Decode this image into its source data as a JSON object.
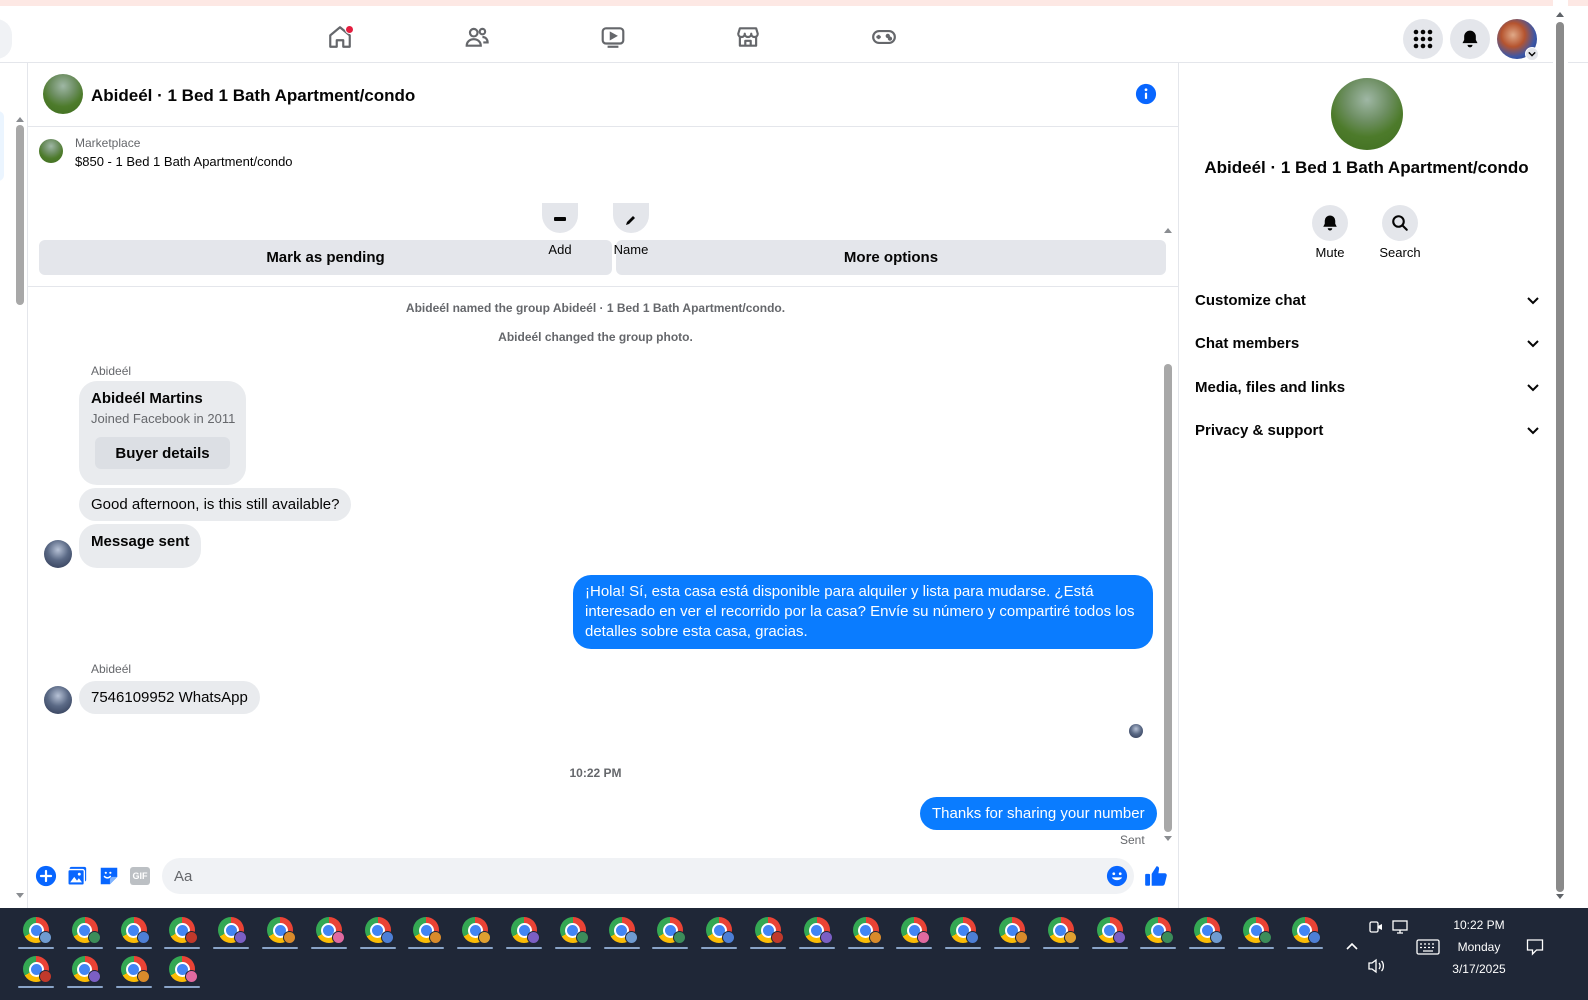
{
  "chat_header": {
    "title": "Abideél · 1 Bed 1 Bath Apartment/condo"
  },
  "marketplace": {
    "label": "Marketplace",
    "listing": "$850 - 1 Bed 1 Bath Apartment/condo",
    "mark_pending": "Mark as pending",
    "more_options": "More options"
  },
  "group_actions": {
    "add": "Add",
    "name": "Name"
  },
  "system_messages": [
    "Abideél named the group Abideél · 1 Bed 1 Bath Apartment/condo.",
    "Abideél changed the group photo."
  ],
  "buyer_card": {
    "sender": "Abideél",
    "name": "Abideél Martins",
    "joined": "Joined Facebook in 2011",
    "details_button": "Buyer details"
  },
  "messages": {
    "m1": "Good afternoon, is this still available?",
    "m2": "Message sent",
    "m3": "¡Hola! Sí, esta casa está disponible para alquiler y lista para mudarse. ¿Está interesado en ver el recorrido por la casa? Envíe su número y compartiré todos los detalles sobre esta casa, gracias.",
    "m4_sender": "Abideél",
    "m4": "7546109952 WhatsApp",
    "timestamp": "10:22 PM",
    "m5": "Thanks for sharing your number",
    "status": "Sent"
  },
  "composer": {
    "placeholder": "Aa",
    "gif": "GIF"
  },
  "right_panel": {
    "title": "Abideél · 1 Bed 1 Bath Apartment/condo",
    "mute": "Mute",
    "search": "Search",
    "sections": [
      "Customize chat",
      "Chat members",
      "Media, files and links",
      "Privacy & support"
    ]
  },
  "taskbar": {
    "time": "10:22 PM",
    "day": "Monday",
    "date": "3/17/2025"
  },
  "colors": {
    "messenger_blue": "#0a7cff",
    "fb_blue": "#0866ff",
    "notification_red": "#e41e3f"
  }
}
